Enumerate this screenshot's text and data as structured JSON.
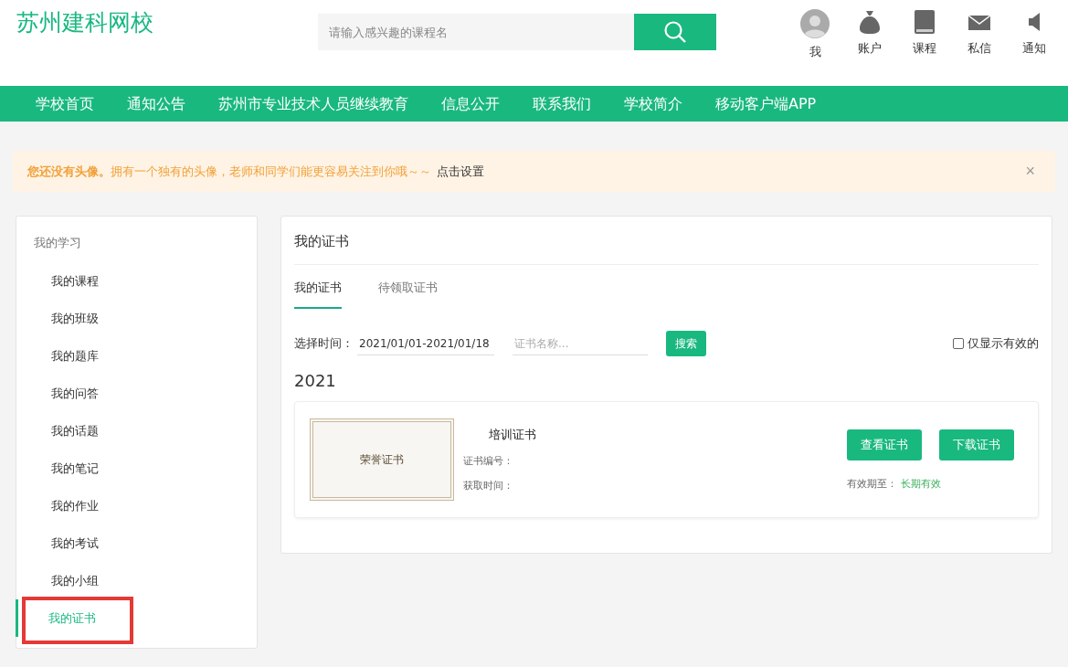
{
  "header": {
    "logo": "苏州建科网校",
    "search": {
      "placeholder": "请输入感兴趣的课程名"
    },
    "actions": [
      {
        "kind": "avatar",
        "label": "我"
      },
      {
        "kind": "money",
        "label": "账户"
      },
      {
        "kind": "book",
        "label": "课程"
      },
      {
        "kind": "mail",
        "label": "私信"
      },
      {
        "kind": "speaker",
        "label": "通知"
      }
    ]
  },
  "nav": [
    "学校首页",
    "通知公告",
    "苏州市专业技术人员继续教育",
    "信息公开",
    "联系我们",
    "学校简介",
    "移动客户端APP"
  ],
  "notice": {
    "text": "您还没有头像。",
    "detail": "拥有一个独有的头像，老师和同学们能更容易关注到你哦～～",
    "link": "点击设置",
    "close": "×"
  },
  "sidebar": {
    "title": "我的学习",
    "items": [
      {
        "label": "我的课程",
        "selected": false
      },
      {
        "label": "我的班级",
        "selected": false
      },
      {
        "label": "我的题库",
        "selected": false
      },
      {
        "label": "我的问答",
        "selected": false
      },
      {
        "label": "我的话题",
        "selected": false
      },
      {
        "label": "我的笔记",
        "selected": false
      },
      {
        "label": "我的作业",
        "selected": false
      },
      {
        "label": "我的考试",
        "selected": false
      },
      {
        "label": "我的小组",
        "selected": false
      },
      {
        "label": "我的证书",
        "selected": true
      }
    ]
  },
  "main": {
    "title": "我的证书",
    "tabs": [
      {
        "label": "我的证书",
        "selected": true
      },
      {
        "label": "待领取证书",
        "selected": false
      }
    ],
    "filter": {
      "label": "选择时间：",
      "date": "2021/01/01-2021/01/18",
      "name_placeholder": "证书名称...",
      "search_button": "搜索",
      "valid_only": {
        "label": "仅显示有效的",
        "checked": false
      }
    },
    "year": "2021",
    "certificates": [
      {
        "image_text": "荣誉证书",
        "name": "培训证书",
        "number_label": "证书编号：",
        "time_label": "获取时间：",
        "view_button": "查看证书",
        "download_button": "下载证书",
        "validity_label": "有效期至：",
        "validity": "长期有效"
      }
    ]
  }
}
